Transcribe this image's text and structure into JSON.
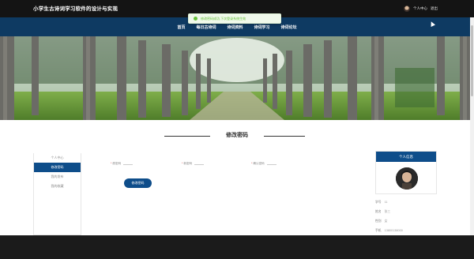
{
  "header": {
    "site_title": "小学生古诗词学习软件的设计与实现",
    "user_center": "个人中心",
    "logout": "退出"
  },
  "toast": {
    "message": "修改密码成功,下次登录系统生效"
  },
  "nav": {
    "items": [
      {
        "label": "首页"
      },
      {
        "label": "每日古诗词"
      },
      {
        "label": "诗词资料"
      },
      {
        "label": "诗词学习"
      },
      {
        "label": "诗词论坛"
      }
    ]
  },
  "page": {
    "title": "修改密码"
  },
  "side_menu": {
    "items": [
      {
        "label": "个人中心",
        "active": false
      },
      {
        "label": "修改密码",
        "active": true
      },
      {
        "label": "我的发布",
        "active": false
      },
      {
        "label": "我的收藏",
        "active": false
      }
    ]
  },
  "form": {
    "required_mark": "*",
    "fields": [
      {
        "label": "原密码"
      },
      {
        "label": "新密码"
      },
      {
        "label": "确认密码"
      }
    ],
    "submit_label": "修改密码"
  },
  "profile": {
    "card_title": "个人信息",
    "info": [
      {
        "label": "学号",
        "value": "11"
      },
      {
        "label": "姓名",
        "value": "张三"
      },
      {
        "label": "性别",
        "value": "女"
      },
      {
        "label": "手机",
        "value": "13800138000"
      }
    ]
  },
  "colors": {
    "nav_bg": "#0e3a62",
    "accent": "#0e4d8a",
    "toast_success": "#67c23a"
  }
}
